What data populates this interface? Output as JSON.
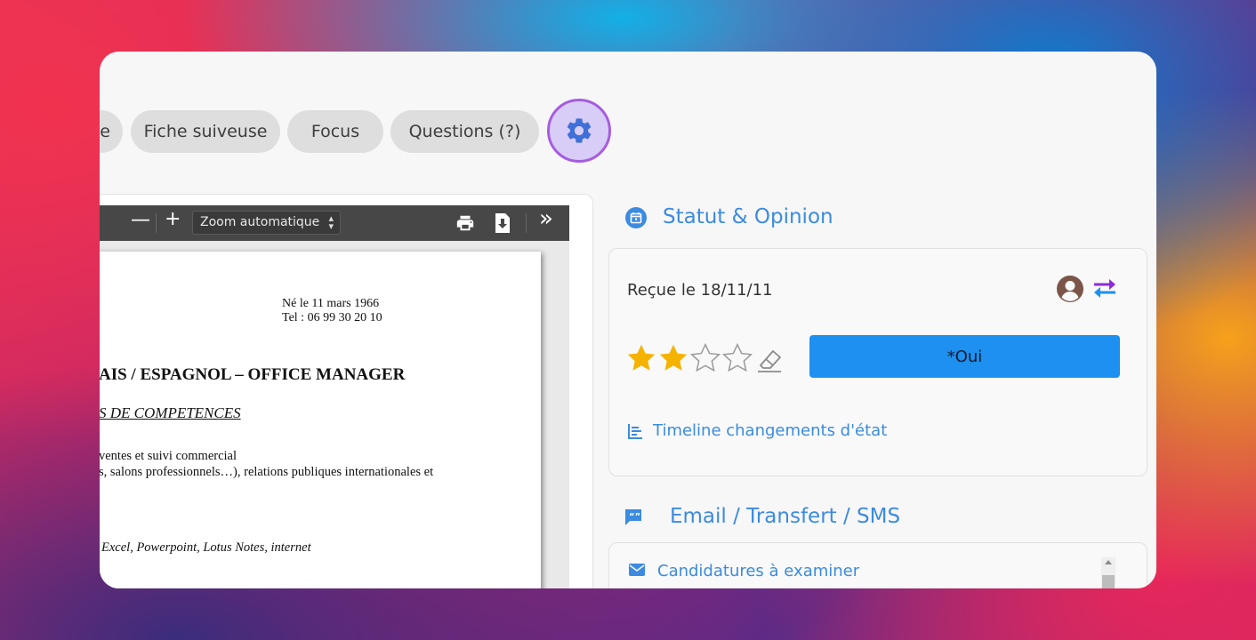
{
  "tabs": [
    {
      "label": "e"
    },
    {
      "label": "Fiche suiveuse"
    },
    {
      "label": "Focus"
    },
    {
      "label": "Questions (?)"
    }
  ],
  "settings_icon": "gear-icon",
  "pdf_viewer": {
    "zoom_label": "Zoom automatique",
    "minus": "—",
    "plus": "+",
    "more": "»",
    "document": {
      "birth": "Né le 11 mars 1966",
      "tel": "Tel : 06 99 30 20 10",
      "title": "AIS / ESPAGNOL – OFFICE MANAGER",
      "section": "S DE COMPETENCES",
      "line1": "ventes et suivi commercial",
      "line2": "s,  salons  professionnels…),  relations  publiques  internationales  et",
      "line3": "Excel, Powerpoint, Lotus Notes, internet"
    }
  },
  "status": {
    "title": "Statut & Opinion",
    "received": "Reçue le 18/11/11",
    "rating": 2,
    "rating_max": 5,
    "answer_button": "*Oui",
    "timeline_link": "Timeline changements d'état",
    "colors": {
      "accent": "#3b8be0",
      "button": "#1e90ef",
      "star": "#f5b301",
      "transfer_purple": "#8e2bd6",
      "transfer_blue": "#1e90ef"
    }
  },
  "email": {
    "title": "Email / Transfert / SMS",
    "item": "Candidatures à examiner"
  }
}
